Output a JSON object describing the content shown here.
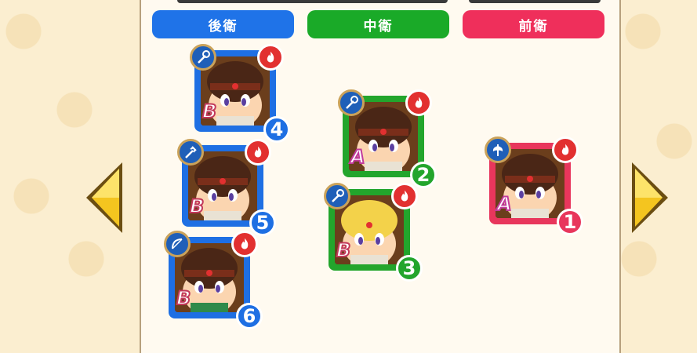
{
  "headers": {
    "back": "後衛",
    "middle": "中衛",
    "front": "前衛"
  },
  "colors": {
    "back": "#1f73e8",
    "middle": "#1aaa28",
    "front": "#ef2f5b",
    "arrow": "#f2c21c"
  },
  "units": [
    {
      "slot": "4",
      "rank": "B",
      "row": "back",
      "weapon_icon": "staff-icon",
      "element_icon": "fire-icon"
    },
    {
      "slot": "5",
      "rank": "B",
      "row": "back",
      "weapon_icon": "staff-icon",
      "element_icon": "fire-icon"
    },
    {
      "slot": "6",
      "rank": "B",
      "row": "back",
      "weapon_icon": "bow-icon",
      "element_icon": "fire-icon"
    },
    {
      "slot": "2",
      "rank": "A",
      "row": "middle",
      "weapon_icon": "staff-icon",
      "element_icon": "fire-icon"
    },
    {
      "slot": "3",
      "rank": "B",
      "row": "middle",
      "weapon_icon": "staff-icon",
      "element_icon": "fire-icon"
    },
    {
      "slot": "1",
      "rank": "A",
      "row": "front",
      "weapon_icon": "axe-icon",
      "element_icon": "fire-icon"
    }
  ],
  "navigation": {
    "prev_icon": "arrow-left-icon",
    "next_icon": "arrow-right-icon"
  }
}
